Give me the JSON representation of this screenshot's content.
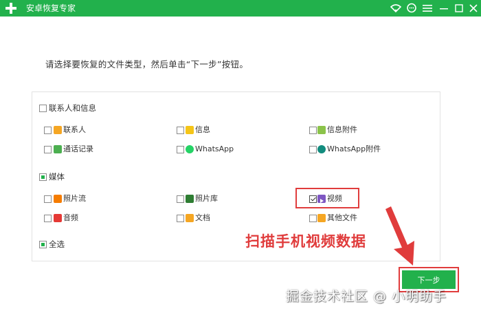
{
  "app": {
    "title": "安卓恢复专家"
  },
  "instruction": "请选择要恢复的文件类型，然后单击“下一步”按钮。",
  "sections": {
    "contacts": {
      "label": "联系人和信息",
      "items": [
        {
          "label": "联系人",
          "icon": "contact-book-icon",
          "color": "#f5a623"
        },
        {
          "label": "信息",
          "icon": "message-icon",
          "color": "#f5c518"
        },
        {
          "label": "信息附件",
          "icon": "attachment-icon",
          "color": "#8bc34a"
        },
        {
          "label": "通话记录",
          "icon": "phone-icon",
          "color": "#4caf50"
        },
        {
          "label": "WhatsApp",
          "icon": "whatsapp-icon",
          "color": "#25d366"
        },
        {
          "label": "WhatsApp附件",
          "icon": "whatsapp-attachment-icon",
          "color": "#128c7e"
        }
      ]
    },
    "media": {
      "label": "媒体",
      "items": [
        {
          "label": "照片流",
          "icon": "photo-stream-icon",
          "color": "#f57c00"
        },
        {
          "label": "照片库",
          "icon": "photo-library-icon",
          "color": "#2e7d32"
        },
        {
          "label": "视频",
          "icon": "video-icon",
          "color": "#7e57c2",
          "checked": true
        },
        {
          "label": "音频",
          "icon": "audio-icon",
          "color": "#e53935"
        },
        {
          "label": "文档",
          "icon": "document-icon",
          "color": "#f5a623"
        },
        {
          "label": "其他文件",
          "icon": "other-files-icon",
          "color": "#f5a623"
        }
      ]
    },
    "select_all": {
      "label": "全选"
    }
  },
  "next_button": {
    "label": "下一步"
  },
  "annotation": "扫描手机视频数据",
  "watermark": "掘金技术社区 @ 小明助手",
  "colors": {
    "brand": "#22b14c",
    "highlight": "#e03c3c"
  }
}
